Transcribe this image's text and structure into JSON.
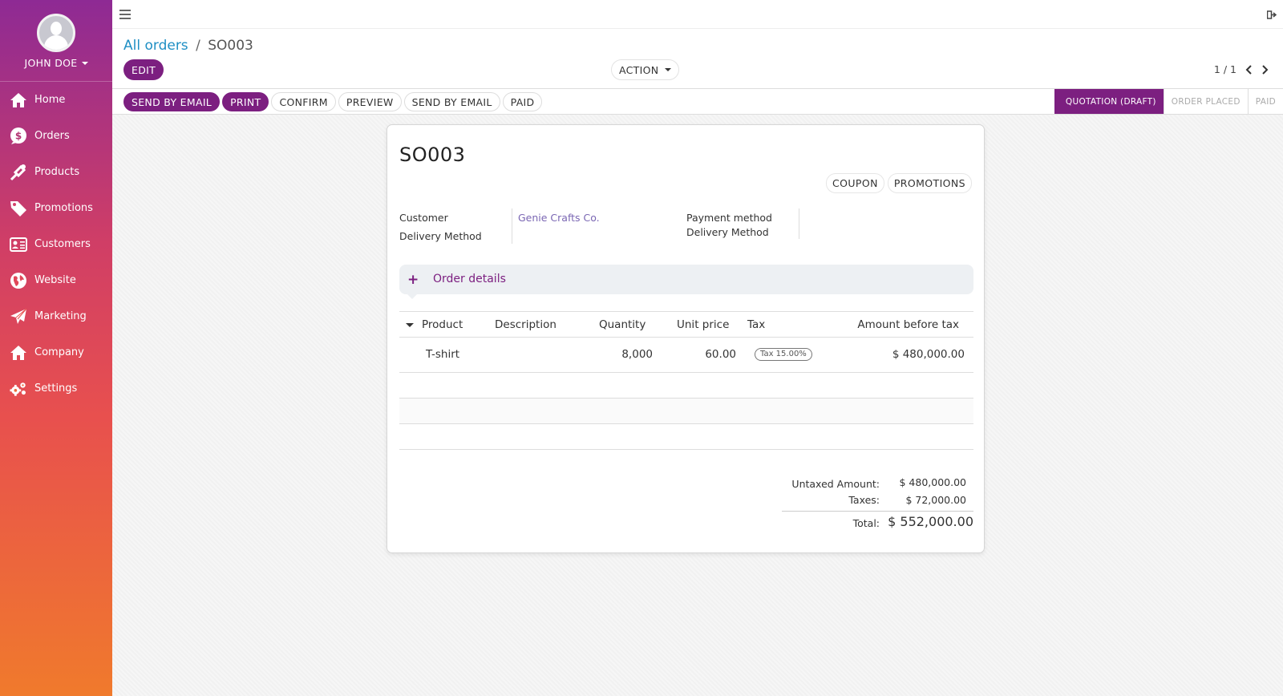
{
  "user": {
    "name": "JOHN DOE"
  },
  "sidebar": {
    "items": [
      {
        "label": "Home",
        "icon": "home-icon"
      },
      {
        "label": "Orders",
        "icon": "dollar-icon"
      },
      {
        "label": "Products",
        "icon": "tag-icon"
      },
      {
        "label": "Promotions",
        "icon": "price-tag-icon"
      },
      {
        "label": "Customers",
        "icon": "id-card-icon"
      },
      {
        "label": "Website",
        "icon": "globe-icon"
      },
      {
        "label": "Marketing",
        "icon": "paper-plane-icon"
      },
      {
        "label": "Company",
        "icon": "building-icon"
      },
      {
        "label": "Settings",
        "icon": "gears-icon"
      }
    ]
  },
  "breadcrumb": {
    "parent": "All orders",
    "separator": "/",
    "current": "SO003"
  },
  "control": {
    "edit_label": "EDIT",
    "action_label": "ACTION",
    "pager": "1 / 1"
  },
  "status_buttons": [
    "SEND BY EMAIL",
    "PRINT",
    "CONFIRM",
    "PREVIEW",
    "SEND BY EMAIL",
    "PAID"
  ],
  "stages": [
    "QUOTATION (DRAFT)",
    "ORDER PLACED",
    "PAID"
  ],
  "order": {
    "title": "SO003",
    "buttons": [
      "COUPON",
      "PROMOTIONS"
    ],
    "customer_label": "Customer",
    "customer_value": "Genie Crafts Co.",
    "delivery_label_left": "Delivery Method",
    "payment_label": "Payment method",
    "delivery_label_right": "Delivery Method",
    "details_label": "Order details"
  },
  "lines": {
    "headers": [
      "Product",
      "Description",
      "Quantity",
      "Unit price",
      "Tax",
      "Amount before tax"
    ],
    "rows": [
      {
        "product": "T-shirt",
        "description": "",
        "quantity": "8,000",
        "unit_price": "60.00",
        "tax": "Tax 15.00%",
        "amount": "$ 480,000.00"
      }
    ]
  },
  "totals": {
    "untaxed_label": "Untaxed Amount:",
    "untaxed_value": "$ 480,000.00",
    "taxes_label": "Taxes:",
    "taxes_value": "$ 72,000.00",
    "total_label": "Total:",
    "total_value": "$ 552,000.00"
  },
  "colors": {
    "brand": "#7c1f80",
    "link": "#1f8fc4"
  }
}
